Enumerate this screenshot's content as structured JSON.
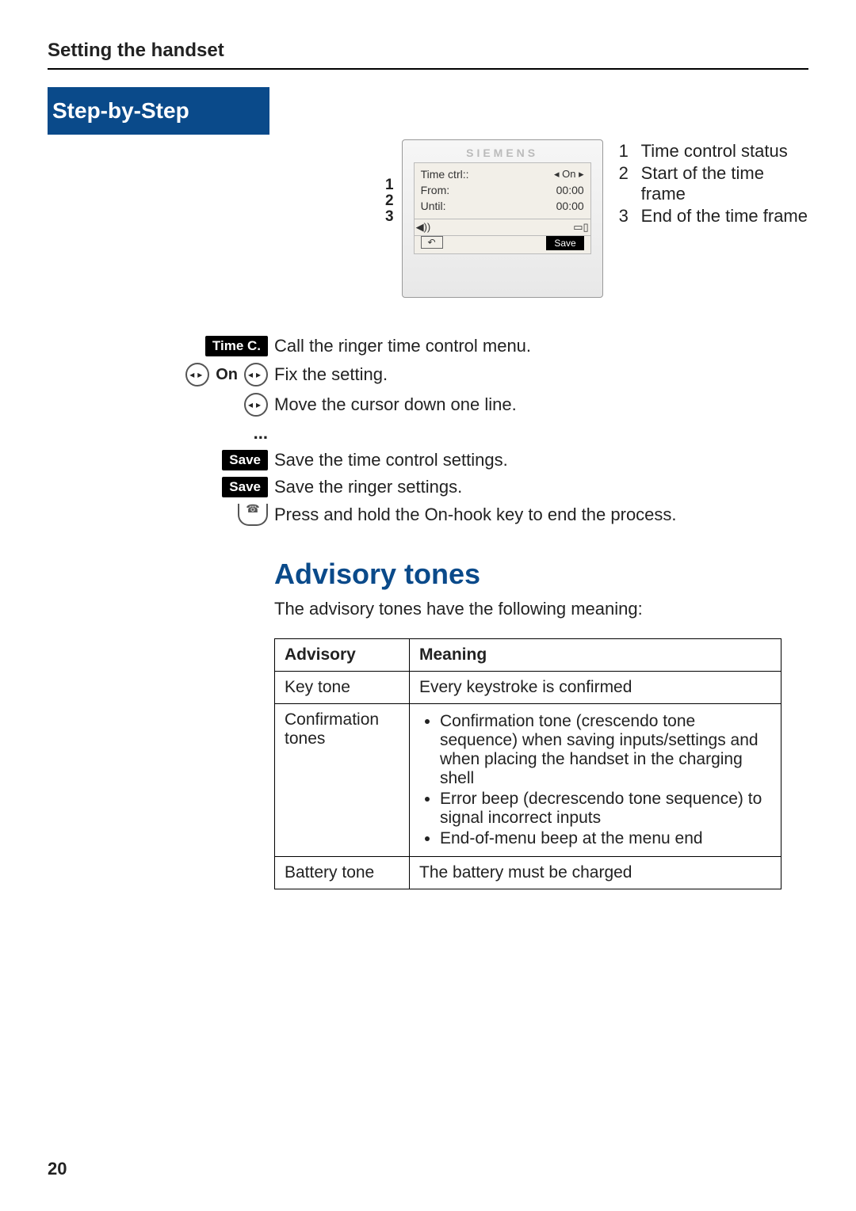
{
  "header": {
    "title": "Setting the handset"
  },
  "banner": "Step-by-Step",
  "display": {
    "brand": "SIEMENS",
    "leaders": [
      "1",
      "2",
      "3"
    ],
    "rows": [
      {
        "label": "Time ctrl::",
        "value": "◂ On ▸"
      },
      {
        "label": "From:",
        "value": "00:00"
      },
      {
        "label": "Until:",
        "value": "00:00"
      }
    ],
    "status_left": "◀))",
    "save_key": "Save"
  },
  "legend": [
    {
      "n": "1",
      "t": "Time control status"
    },
    {
      "n": "2",
      "t": "Start of the time frame"
    },
    {
      "n": "3",
      "t": "End of the time frame"
    }
  ],
  "instructions": [
    {
      "icon": "softkey",
      "label": "Time C.",
      "text": "Call the ringer time control menu."
    },
    {
      "icon": "nav-on",
      "label": "On",
      "text": "Fix the setting."
    },
    {
      "icon": "nav",
      "label": "",
      "text": "Move the cursor down one line."
    },
    {
      "icon": "dots",
      "label": "...",
      "text": ""
    },
    {
      "icon": "softkey",
      "label": "Save",
      "text": "Save the time control settings."
    },
    {
      "icon": "softkey",
      "label": "Save",
      "text": "Save the ringer settings."
    },
    {
      "icon": "onhook",
      "label": "",
      "text": "Press and hold the On-hook key to end the process."
    }
  ],
  "section": {
    "heading": "Advisory tones",
    "intro": "The advisory tones have the following meaning:",
    "th1": "Advisory",
    "th2": "Meaning",
    "rows": {
      "r1c1": "Key tone",
      "r1c2": "Every keystroke is confirmed",
      "r2c1": "Confirmation tones",
      "r2b1": "Confirmation tone (crescendo tone sequence) when saving inputs/settings and when placing the handset in the charging shell",
      "r2b2": "Error beep (decrescendo tone sequence) to signal incorrect inputs",
      "r2b3": "End-of-menu beep at the menu end",
      "r3c1": "Battery tone",
      "r3c2": "The battery must be charged"
    }
  },
  "page_number": "20"
}
